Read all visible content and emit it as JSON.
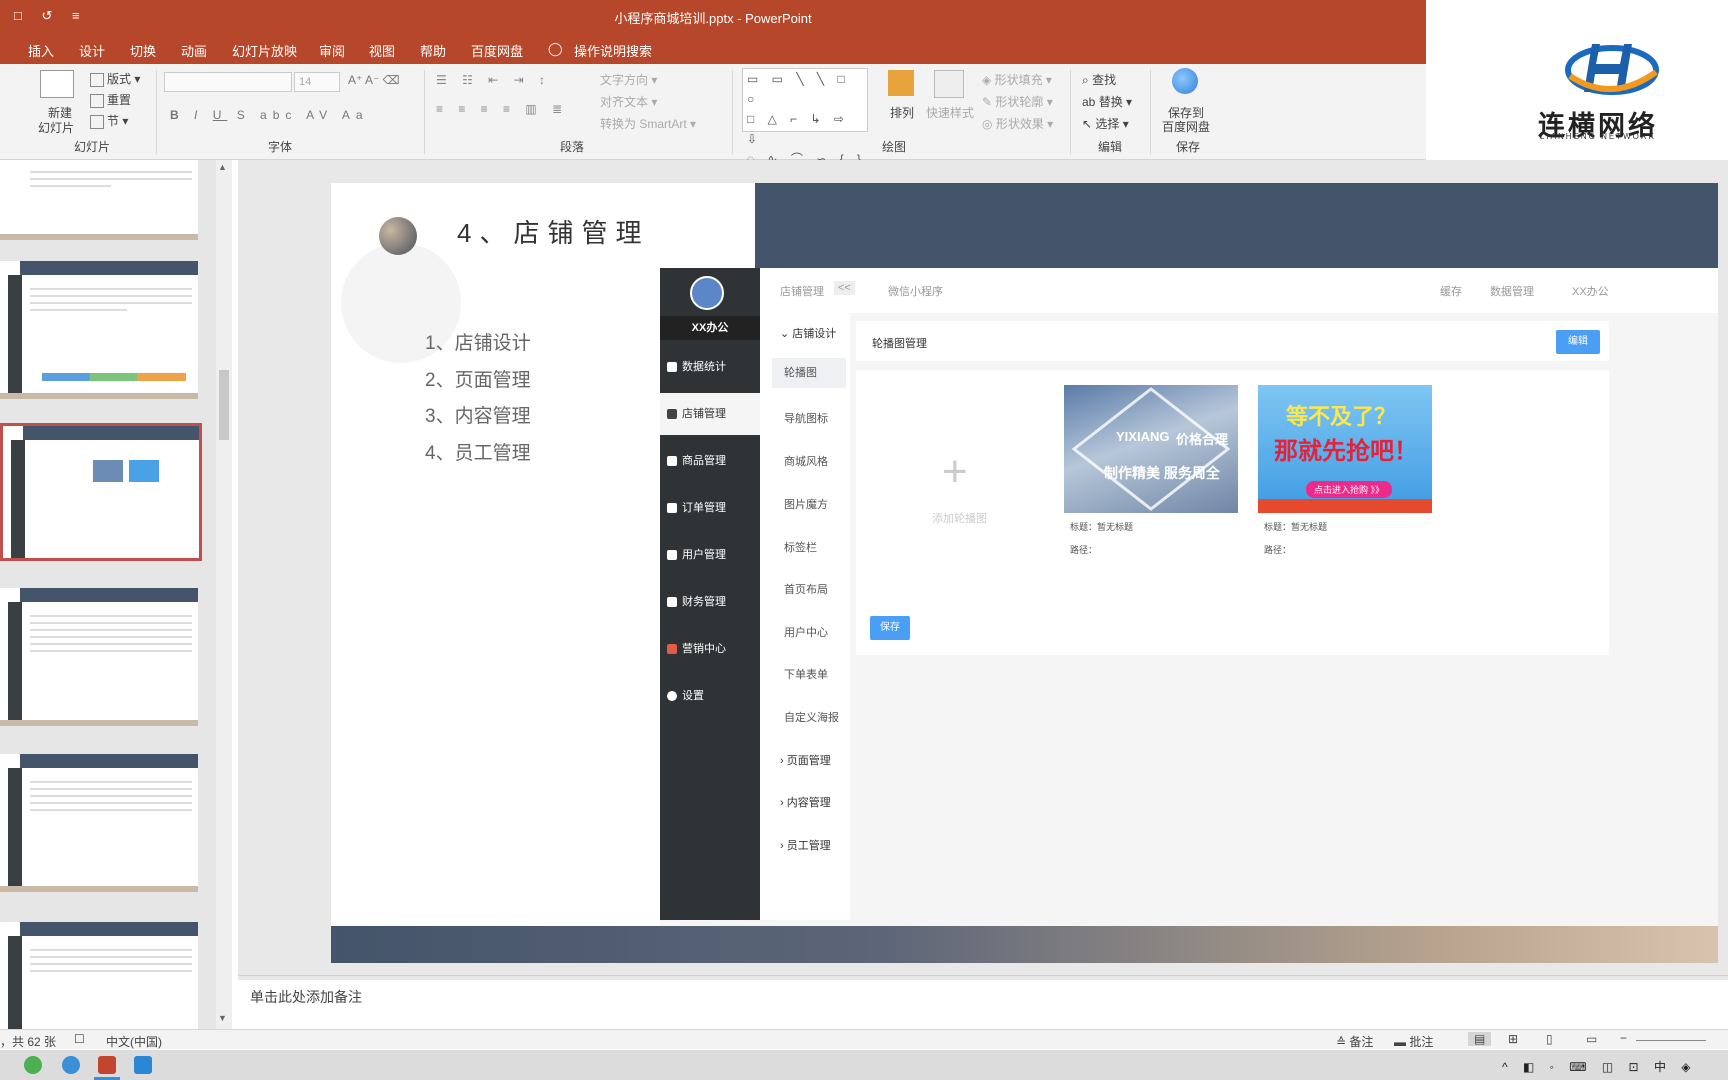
{
  "window": {
    "title": "小程序商城培训.pptx - PowerPoint",
    "quick_access": "□ ↺ ≡"
  },
  "menu": {
    "items": [
      "插入",
      "设计",
      "切换",
      "动画",
      "幻灯片放映",
      "审阅",
      "视图",
      "帮助",
      "百度网盘"
    ],
    "tell_me": "操作说明搜索"
  },
  "ribbon": {
    "slides_group": {
      "new_slide": "新建\n幻灯片",
      "new_slide_l1": "新建",
      "new_slide_l2": "幻灯片",
      "layout": "版式",
      "reset": "重置",
      "section": "节",
      "label": "幻灯片"
    },
    "font_group": {
      "font_size": "14",
      "label": "字体"
    },
    "paragraph_group": {
      "text_direction": "文字方向",
      "align_text": "对齐文本",
      "smartart": "转换为 SmartArt",
      "label": "段落"
    },
    "drawing_group": {
      "arrange": "排列",
      "quick_styles": "快速样式",
      "shape_fill": "形状填充",
      "shape_outline": "形状轮廓",
      "shape_effects": "形状效果",
      "label": "绘图"
    },
    "editing_group": {
      "find": "查找",
      "replace": "替换",
      "select": "选择",
      "label": "编辑"
    },
    "save_group": {
      "save_to_baidu_l1": "保存到",
      "save_to_baidu_l2": "百度网盘",
      "label": "保存"
    }
  },
  "logo": {
    "name": "连横网络",
    "sub": "LIANHENG NETWORK"
  },
  "slide": {
    "title": "4、店铺管理",
    "agenda": [
      "1、店铺设计",
      "2、页面管理",
      "3、内容管理",
      "4、员工管理"
    ]
  },
  "admin": {
    "brand": "XX办公",
    "nav": [
      "数据统计",
      "店铺管理",
      "商品管理",
      "订单管理",
      "用户管理",
      "财务管理",
      "营销中心",
      "设置"
    ],
    "top": {
      "breadcrumb": "店铺管理",
      "collapse": "<<",
      "tab": "微信小程序",
      "cache": "缓存",
      "data_mgmt": "数据管理",
      "user": "XX办公"
    },
    "sub_head": "店铺设计",
    "sub_items": [
      "轮播图",
      "导航图标",
      "商城风格",
      "图片魔方",
      "标签栏",
      "首页布局",
      "用户中心",
      "下单表单",
      "自定义海报"
    ],
    "sub_groups": [
      "页面管理",
      "内容管理",
      "员工管理"
    ],
    "card_title": "轮播图管理",
    "edit_button": "编辑",
    "add_banner": "添加轮播图",
    "banners": [
      {
        "label": "标题：暂无标题",
        "path": "路径：",
        "line1": "YIXIANG",
        "line2": "价格合理",
        "line3": "制作精美 服务周全"
      },
      {
        "label": "标题：暂无标题",
        "path": "路径：",
        "line1": "等不及了？",
        "line2": "那就先抢吧！",
        "line3": "点击进入抢购 》》"
      }
    ],
    "save_button": "保存"
  },
  "notes": {
    "placeholder": "单击此处添加备注"
  },
  "status": {
    "slide_count": "，共 62 张",
    "language": "中文(中国)",
    "notes_btn": "备注",
    "comments_btn": "批注"
  },
  "taskbar": {
    "ime": "中",
    "tray": "^ ◧ ◦ ⌨ ◫ ⊡ 中 ◈"
  }
}
